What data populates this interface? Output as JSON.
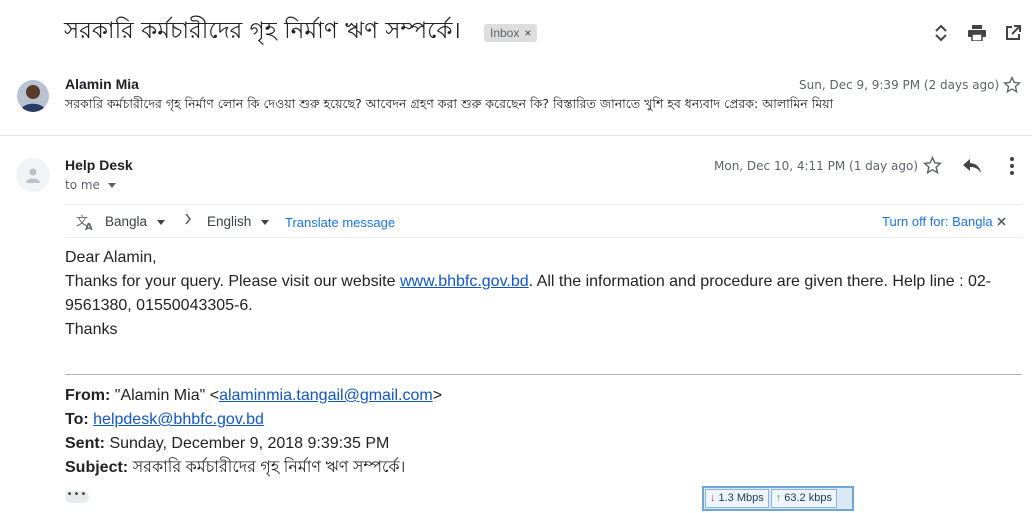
{
  "thread": {
    "subject": "সরকারি কর্মচারীদের গৃহ নির্মাণ ঋণ সম্পর্কে।",
    "label_chip": "Inbox",
    "label_chip_remove": "×"
  },
  "message1": {
    "sender": "Alamin Mia",
    "date": "Sun, Dec 9, 9:39 PM (2 days ago)",
    "snippet": "সরকারি কর্মচারীদের গৃহ নির্মাণ লোন কি দেওয়া শুরু হয়েছে? আবেদন গ্রহণ করা শুরু করেছেন কি? বিস্তারিত জানাতে খুশি হব ধন্যবাদ প্রেরক: আলামিন মিয়া"
  },
  "message2": {
    "sender": "Help Desk",
    "recipient_line": "to me",
    "date": "Mon, Dec 10, 4:11 PM (1 day ago)"
  },
  "translate_bar": {
    "source_language": "Bangla",
    "target_language": "English",
    "translate_link": "Translate message",
    "turn_off_link": "Turn off for: Bangla"
  },
  "body": {
    "greeting": "Dear Alamin,",
    "line1_before_link": "Thanks for your query. Please visit our website ",
    "website": "www.bhbfc.gov.bd",
    "line1_after_link": ". All the information and procedure are given there. Help line : 02-",
    "line2": "9561380, 01550043305-6.",
    "closing": "Thanks"
  },
  "quoted": {
    "from_label": "From:",
    "from_name": " \"Alamin Mia\" <",
    "from_email": "alaminmia.tangail@gmail.com",
    "from_close": ">",
    "to_label": "To:",
    "to_email": "helpdesk@bhbfc.gov.bd",
    "sent_label": "Sent:",
    "sent_value": " Sunday, December 9, 2018 9:39:35 PM",
    "subject_label": "Subject:",
    "subject_value": " সরকারি কর্মচারীদের গৃহ নির্মাণ ঋণ সম্পর্কে।"
  },
  "show_trimmed": "•••",
  "network_monitor": {
    "download": "1.3 Mbps",
    "upload": "63.2 kbps"
  },
  "colors": {
    "link": "#1155cc",
    "translate_link": "#1a73e8",
    "chip_bg": "#dddddd",
    "monitor_border": "#6fa6d6"
  }
}
